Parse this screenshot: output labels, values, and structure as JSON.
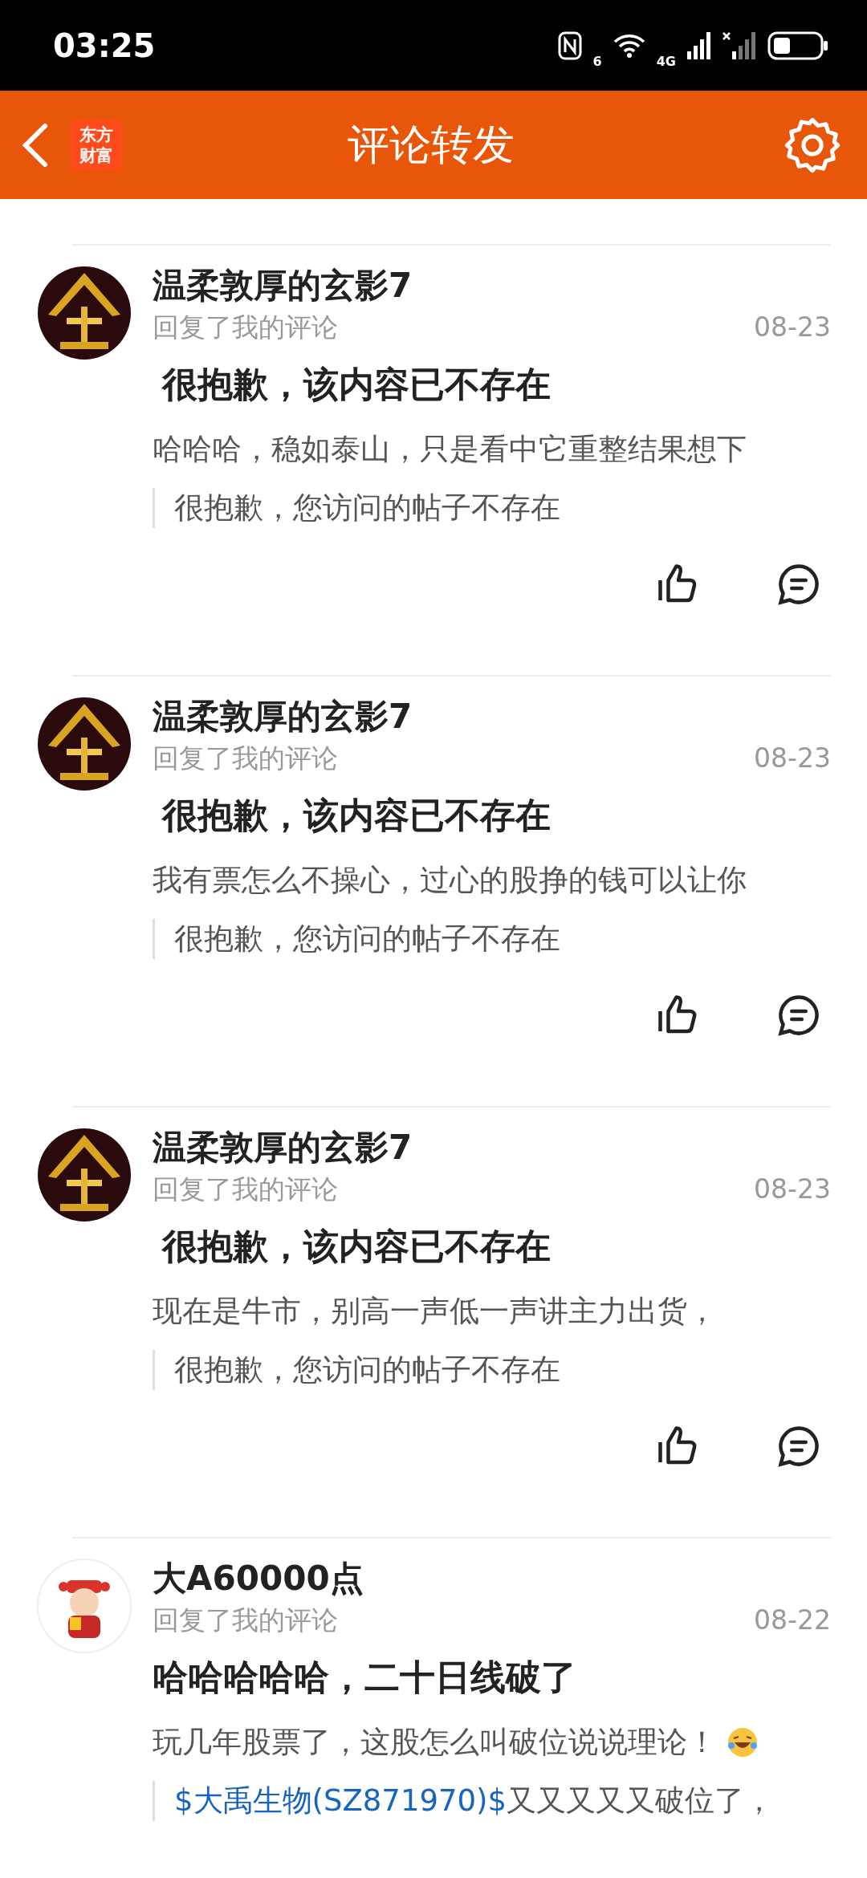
{
  "status_bar": {
    "time": "03:25",
    "wifi_badge": "6",
    "cell_badge": "4G"
  },
  "header": {
    "logo_lines": [
      "东方",
      "财富"
    ],
    "title": "评论转发"
  },
  "comments": [
    {
      "kind": "gold",
      "user": "温柔敦厚的玄影7",
      "action": "回复了我的评论",
      "date": "08-23",
      "title": "很抱歉，该内容已不存在",
      "title_indented": true,
      "body": "哈哈哈，稳如泰山，只是看中它重整结果想下",
      "emoji": false,
      "quote": [
        {
          "kind": "text",
          "text": "很抱歉，您访问的帖子不存在"
        }
      ],
      "actions": true
    },
    {
      "kind": "gold",
      "user": "温柔敦厚的玄影7",
      "action": "回复了我的评论",
      "date": "08-23",
      "title": "很抱歉，该内容已不存在",
      "title_indented": true,
      "body": "我有票怎么不操心，过心的股挣的钱可以让你",
      "emoji": false,
      "quote": [
        {
          "kind": "text",
          "text": "很抱歉，您访问的帖子不存在"
        }
      ],
      "actions": true
    },
    {
      "kind": "gold",
      "user": "温柔敦厚的玄影7",
      "action": "回复了我的评论",
      "date": "08-23",
      "title": "很抱歉，该内容已不存在",
      "title_indented": true,
      "body": "现在是牛市，别高一声低一声讲主力出货，",
      "emoji": false,
      "quote": [
        {
          "kind": "text",
          "text": "很抱歉，您访问的帖子不存在"
        }
      ],
      "actions": true
    },
    {
      "kind": "figure",
      "user": "大A60000点",
      "action": "回复了我的评论",
      "date": "08-22",
      "title": "哈哈哈哈哈，二十日线破了",
      "title_indented": false,
      "body": "玩几年股票了，这股怎么叫破位说说理论！",
      "emoji": true,
      "quote": [
        {
          "kind": "link",
          "text": "$大禹生物(SZ871970)$"
        },
        {
          "kind": "text",
          "text": "又又又又又破位了，"
        }
      ],
      "actions": false
    }
  ]
}
